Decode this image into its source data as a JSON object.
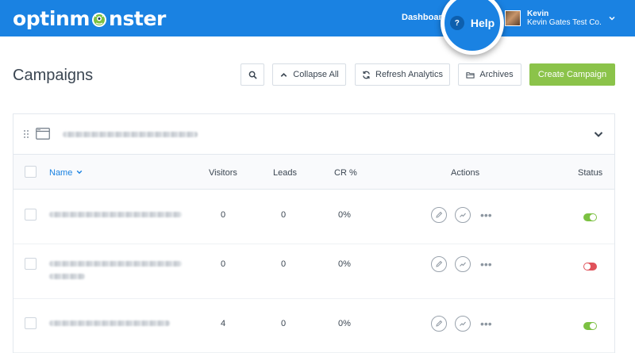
{
  "header": {
    "logo_text_left": "optinm",
    "logo_text_right": "nster",
    "nav_dashboard": "Dashboard",
    "help_label": "Help",
    "help_icon_text": "?",
    "user_name": "Kevin",
    "user_org": "Kevin Gates Test Co."
  },
  "page": {
    "title": "Campaigns"
  },
  "toolbar": {
    "collapse_label": "Collapse All",
    "refresh_label": "Refresh Analytics",
    "archives_label": "Archives",
    "create_label": "Create Campaign"
  },
  "table": {
    "columns": {
      "name": "Name",
      "visitors": "Visitors",
      "leads": "Leads",
      "cr": "CR %",
      "actions": "Actions",
      "status": "Status"
    },
    "rows": [
      {
        "visitors": "0",
        "leads": "0",
        "cr": "0%",
        "status": "on"
      },
      {
        "visitors": "0",
        "leads": "0",
        "cr": "0%",
        "status": "off"
      },
      {
        "visitors": "4",
        "leads": "0",
        "cr": "0%",
        "status": "on"
      }
    ]
  },
  "colors": {
    "brand_blue": "#1a82e2",
    "create_green": "#8bc34a",
    "toggle_on": "#7cc142",
    "toggle_off": "#e0525a"
  },
  "icons": {
    "search": "search-icon",
    "collapse": "chevron-up-icon",
    "refresh": "refresh-icon",
    "archives": "folder-icon",
    "edit": "pencil-icon",
    "analytics": "trend-line-icon",
    "more": "more-dots-icon"
  }
}
